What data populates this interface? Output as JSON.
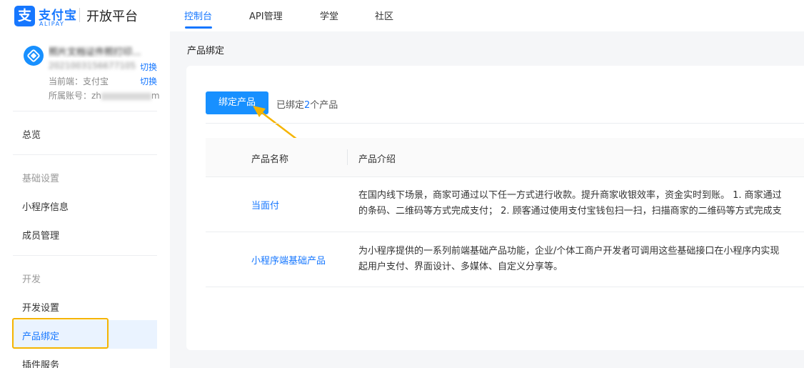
{
  "header": {
    "logo_char": "支",
    "brand": "支付宝",
    "brand_sub": "ALIPAY",
    "platform": "开放平台",
    "nav": [
      "控制台",
      "API管理",
      "学堂",
      "社区"
    ],
    "active_nav": "控制台"
  },
  "sidebar": {
    "app": {
      "name": "照片文档证件照打印...",
      "id": "2021003156677105",
      "switch_label": "切换",
      "current_end_label": "当前端：支付宝",
      "account_label": "所属账号：zh",
      "account_suffix": "m"
    },
    "items": {
      "overview": "总览",
      "basic_group": "基础设置",
      "miniapp_info": "小程序信息",
      "members": "成员管理",
      "dev_group": "开发",
      "dev_settings": "开发设置",
      "product_binding": "产品绑定",
      "plugin_service": "插件服务"
    },
    "active_item": "产品绑定"
  },
  "main": {
    "page_title": "产品绑定",
    "bind_button": "绑定产品",
    "bound_prefix": "已绑定",
    "bound_count": "2",
    "bound_suffix": "个产品",
    "table": {
      "columns": [
        "产品名称",
        "产品介绍"
      ],
      "rows": [
        {
          "name": "当面付",
          "desc_line1": "在国内线下场景，商家可通过以下任一方式进行收款。提升商家收银效率，资金实时到账。 1. 商家通过",
          "desc_line2": "的条码、二维码等方式完成支付； 2. 顾客通过使用支付宝钱包扫一扫，扫描商家的二维码等方式完成支"
        },
        {
          "name": "小程序端基础产品",
          "desc_line1": "为小程序提供的一系列前端基础产品功能，企业/个体工商户开发者可调用这些基础接口在小程序内实现",
          "desc_line2": "起用户支付、界面设计、多媒体、自定义分享等。"
        }
      ]
    }
  },
  "colors": {
    "accent": "#1677ff",
    "button": "#1890ff",
    "highlight": "#f5b400"
  }
}
